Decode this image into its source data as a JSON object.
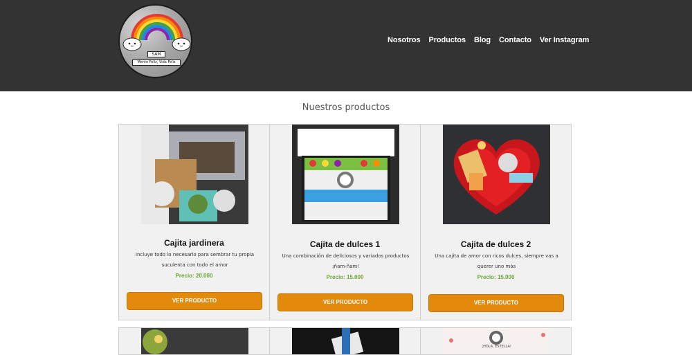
{
  "logo": {
    "line1": "SAM",
    "line2": "Mente Feliz, Vida Feliz"
  },
  "nav": [
    "Nosotros",
    "Productos",
    "Blog",
    "Contacto",
    "Ver Instagram"
  ],
  "section_title": "Nuestros productos",
  "products": [
    {
      "title": "Cajita jardinera",
      "description": "Incluye todo lo necesario para sembrar tu propia suculenta con todo el amor",
      "price": "Precio: 20.000",
      "button": "VER PRODUCTO",
      "image_icon": "garden-box-photo"
    },
    {
      "title": "Cajita de dulces 1",
      "description": "Una combinación de deliciosos y variados productos ¡ñam-ñam!",
      "price": "Precio: 15.000",
      "button": "VER PRODUCTO",
      "image_icon": "candy-box-photo"
    },
    {
      "title": "Cajita de dulces 2",
      "description": "Una cajita de amor con ricos dulces, siempre vas a querer uno más",
      "price": "Precio: 15.000",
      "button": "VER PRODUCTO",
      "image_icon": "heart-candy-box-photo"
    }
  ],
  "row2_partial_text": "¡HOLA, ESTELLA!",
  "colors": {
    "header": "#333333",
    "button": "#e38a0d",
    "price": "#6aa832",
    "card": "#f1f1f1"
  }
}
